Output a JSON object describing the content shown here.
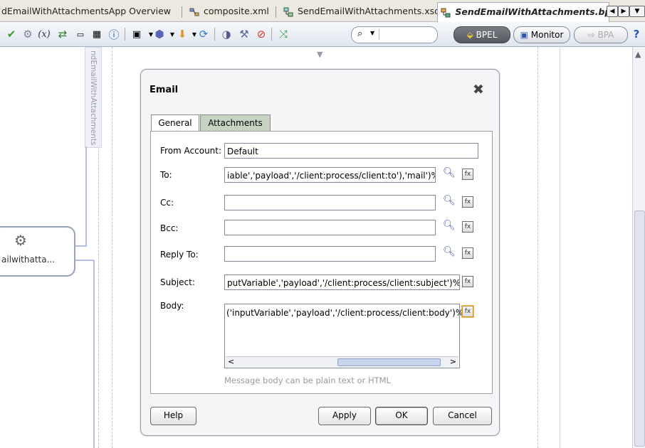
{
  "tabs": [
    {
      "label": "dEmailWithAttachmentsApp Overview"
    },
    {
      "label": "composite.xml"
    },
    {
      "label": "SendEmailWithAttachments.xsd"
    },
    {
      "label": "SendEmailWithAttachments.bp"
    }
  ],
  "toolbar": {
    "mode_buttons": {
      "bpel": "BPEL",
      "monitor": "Monitor",
      "bpa": "BPA"
    }
  },
  "canvas": {
    "lane_label": "ndEmailWithAttachments",
    "node_label": "ailwithatta..."
  },
  "dialog": {
    "title": "Email",
    "tabs": {
      "general": "General",
      "attachments": "Attachments"
    },
    "fields": {
      "from_label": "From Account:",
      "from_value": "Default",
      "to_label": "To:",
      "to_value": "iable','payload','/client:process/client:to'),'mail')%>",
      "cc_label": "Cc:",
      "cc_value": "",
      "bcc_label": "Bcc:",
      "bcc_value": "",
      "replyto_label": "Reply To:",
      "replyto_value": "",
      "subject_label": "Subject:",
      "subject_value": "putVariable','payload','/client:process/client:subject')%>",
      "body_label": "Body:",
      "body_value": "('inputVariable','payload','/client:process/client:body')%>"
    },
    "hint": "Message body can be plain text or HTML",
    "buttons": {
      "help": "Help",
      "apply": "Apply",
      "ok": "OK",
      "cancel": "Cancel"
    }
  },
  "colors": {
    "accent": "#4a5dab",
    "tab_inactive": "#c5d3c0",
    "connector": "#b4bcf0"
  }
}
